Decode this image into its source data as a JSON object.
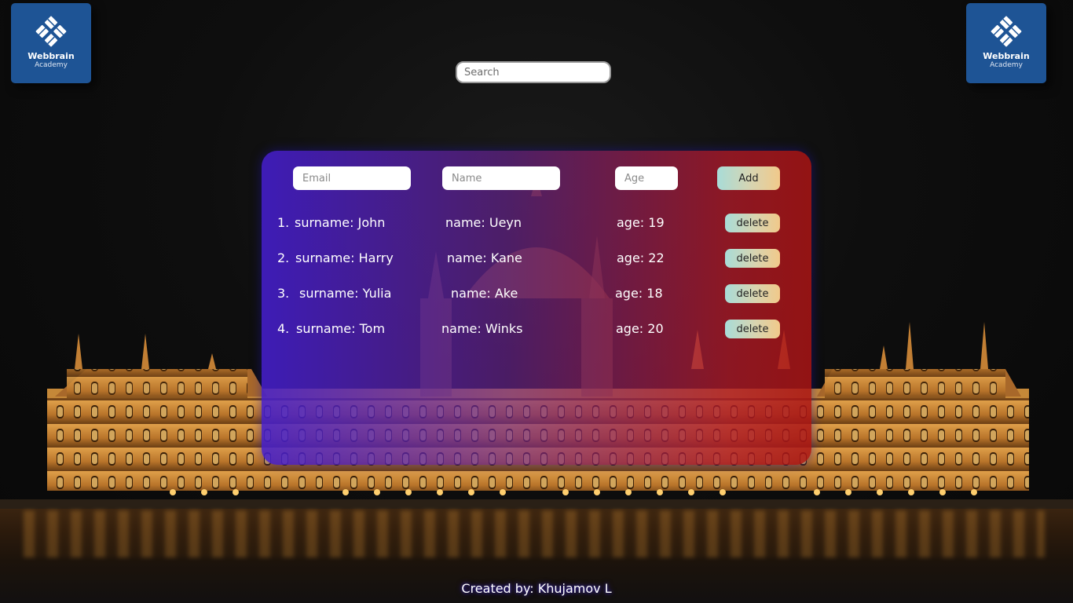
{
  "colors": {
    "logo_bg": "#1e5495",
    "panel_gradient_start": "#441ecd",
    "panel_gradient_end": "#aa1414",
    "button_gradient_start": "#a8dcd8",
    "button_gradient_end": "#f1c98a"
  },
  "logos": {
    "left": {
      "title": "Webbrain",
      "subtitle": "Academy",
      "icon": "webbrain-logo-icon"
    },
    "right": {
      "title": "Webbrain",
      "subtitle": "Academy",
      "icon": "webbrain-logo-icon"
    }
  },
  "search": {
    "placeholder": "Search",
    "value": ""
  },
  "form": {
    "email_placeholder": "Email",
    "name_placeholder": "Name",
    "age_placeholder": "Age",
    "add_label": "Add"
  },
  "rows": [
    {
      "num": "1.",
      "surname": "surname: John",
      "name": "name: Ueyn",
      "age": "age: 19",
      "delete_label": "delete"
    },
    {
      "num": "2.",
      "surname": "surname: Harry",
      "name": "name: Kane",
      "age": "age: 22",
      "delete_label": "delete"
    },
    {
      "num": "3.",
      "surname": "surname: Yulia",
      "name": "name: Ake",
      "age": "age: 18",
      "delete_label": "delete"
    },
    {
      "num": "4.",
      "surname": "surname: Tom",
      "name": "name: Winks",
      "age": "age: 20",
      "delete_label": "delete"
    }
  ],
  "footer": {
    "credit": "Created by: Khujamov L"
  }
}
